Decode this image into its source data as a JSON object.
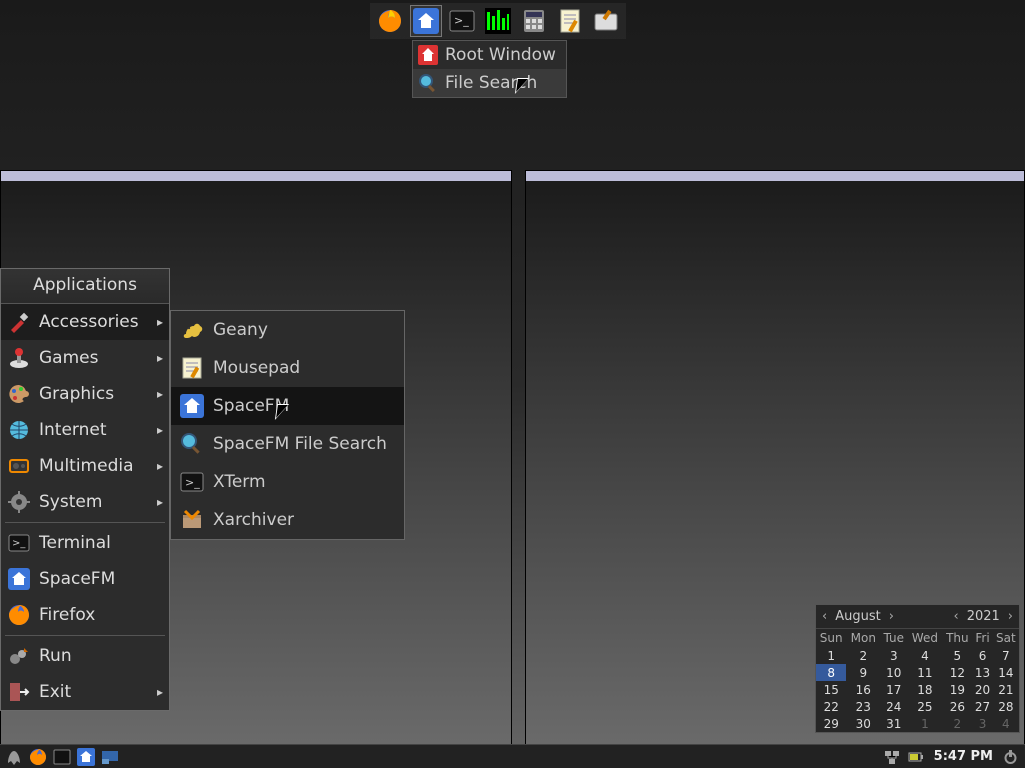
{
  "launcher": {
    "items": [
      "firefox",
      "file-manager",
      "terminal",
      "htop",
      "calculator",
      "text-editor",
      "settings"
    ]
  },
  "launcher_menu": {
    "items": [
      {
        "label": "Root Window",
        "icon": "home-red"
      },
      {
        "label": "File Search",
        "icon": "search"
      }
    ]
  },
  "app_menu": {
    "title": "Applications",
    "cats": [
      {
        "label": "Accessories",
        "icon": "knife"
      },
      {
        "label": "Games",
        "icon": "joystick"
      },
      {
        "label": "Graphics",
        "icon": "palette"
      },
      {
        "label": "Internet",
        "icon": "globe"
      },
      {
        "label": "Multimedia",
        "icon": "media"
      },
      {
        "label": "System",
        "icon": "gear"
      }
    ],
    "pins": [
      {
        "label": "Terminal",
        "icon": "terminal"
      },
      {
        "label": "SpaceFM",
        "icon": "home-blue"
      },
      {
        "label": "Firefox",
        "icon": "firefox"
      }
    ],
    "foot": [
      {
        "label": "Run",
        "icon": "run"
      },
      {
        "label": "Exit",
        "icon": "exit"
      }
    ]
  },
  "submenu": {
    "items": [
      {
        "label": "Geany",
        "icon": "geany"
      },
      {
        "label": "Mousepad",
        "icon": "notepad"
      },
      {
        "label": "SpaceFM",
        "icon": "home-blue"
      },
      {
        "label": "SpaceFM File Search",
        "icon": "search"
      },
      {
        "label": "XTerm",
        "icon": "terminal"
      },
      {
        "label": "Xarchiver",
        "icon": "archive"
      }
    ]
  },
  "calendar": {
    "month": "August",
    "year": "2021",
    "dow": [
      "Sun",
      "Mon",
      "Tue",
      "Wed",
      "Thu",
      "Fri",
      "Sat"
    ],
    "rows": [
      [
        "1",
        "2",
        "3",
        "4",
        "5",
        "6",
        "7"
      ],
      [
        "8",
        "9",
        "10",
        "11",
        "12",
        "13",
        "14"
      ],
      [
        "15",
        "16",
        "17",
        "18",
        "19",
        "20",
        "21"
      ],
      [
        "22",
        "23",
        "24",
        "25",
        "26",
        "27",
        "28"
      ],
      [
        "29",
        "30",
        "31",
        "1",
        "2",
        "3",
        "4"
      ]
    ],
    "selected": "8"
  },
  "taskbar": {
    "clock": "5:47 PM"
  }
}
